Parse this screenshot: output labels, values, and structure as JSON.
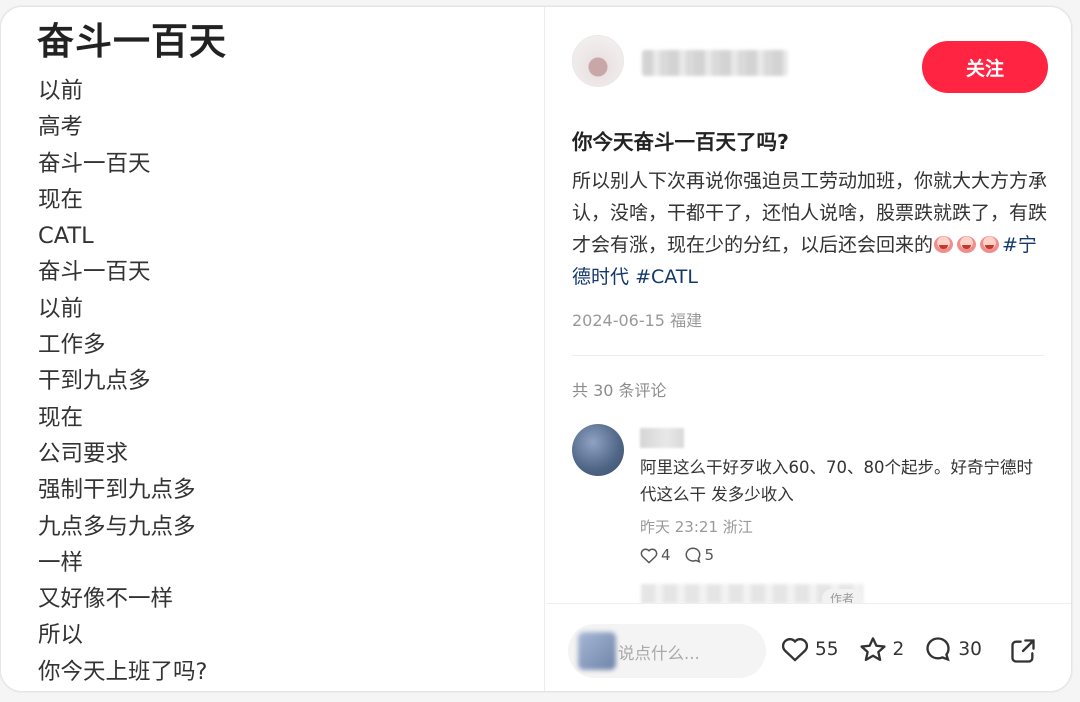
{
  "image_card": {
    "title": "奋斗一百天",
    "lines": [
      "以前",
      "高考",
      "奋斗一百天",
      "现在",
      "CATL",
      "奋斗一百天",
      "以前",
      "工作多",
      "干到九点多",
      "现在",
      "公司要求",
      "强制干到九点多",
      "九点多与九点多",
      "一样",
      "又好像不一样",
      "所以",
      "你今天上班了吗?"
    ]
  },
  "author": {
    "follow_label": "关注"
  },
  "post": {
    "title": "你今天奋斗一百天了吗?",
    "body": "所以别人下次再说你强迫员工劳动加班，你就大大方方承认，没啥，干都干了，还怕人说啥，股票跌就跌了，有跌才会有涨，现在少的分红，以后还会回来的",
    "emoji_name": "crying-face-emoji",
    "emoji_count": 3,
    "hashtags": [
      "#宁德时代",
      "#CATL"
    ],
    "date": "2024-06-15",
    "location": "福建"
  },
  "comments": {
    "count_label": "共 30 条评论",
    "items": [
      {
        "text": "阿里这么干好歹收入60、70、80个起步。好奇宁德时代这么干 发多少收入",
        "time": "昨天 23:21",
        "location": "浙江",
        "likes": "4",
        "replies": "5"
      }
    ],
    "author_tag": "作者"
  },
  "bottom_bar": {
    "input_placeholder": "说点什么...",
    "likes": "55",
    "favorites": "2",
    "comments": "30"
  },
  "colors": {
    "accent": "#ff2442",
    "hashtag": "#13386c"
  }
}
